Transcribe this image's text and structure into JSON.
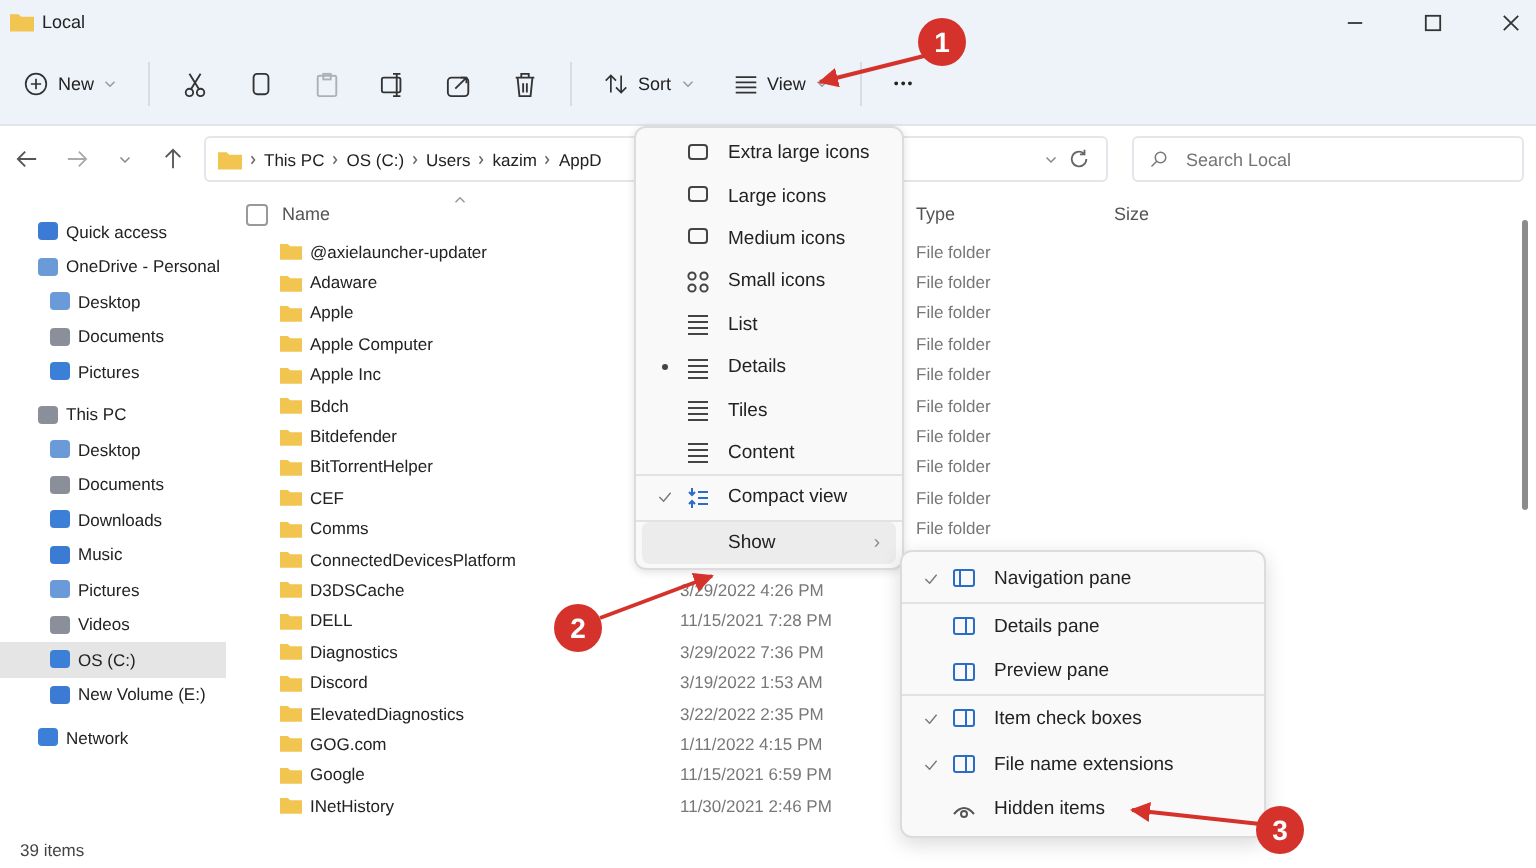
{
  "window": {
    "title": "Local"
  },
  "toolbar": {
    "new": "New",
    "tools": [
      {
        "kind": "cut",
        "disabled": false
      },
      {
        "kind": "copy",
        "disabled": false
      },
      {
        "kind": "paste",
        "disabled": true
      },
      {
        "kind": "rename",
        "disabled": false
      },
      {
        "kind": "share",
        "disabled": false
      },
      {
        "kind": "delete",
        "disabled": false
      }
    ],
    "sort": "Sort",
    "view": "View",
    "more": "•••"
  },
  "address": {
    "crumbs": [
      "This PC",
      "OS (C:)",
      "Users",
      "kazim",
      "AppD"
    ],
    "search_placeholder": "Search Local"
  },
  "sidebar": {
    "items": [
      {
        "label": "Quick access",
        "selected": false
      },
      {
        "label": "OneDrive - Personal",
        "selected": false,
        "children": [
          {
            "label": "Desktop",
            "selected": false
          },
          {
            "label": "Documents",
            "selected": false
          },
          {
            "label": "Pictures",
            "selected": false
          }
        ]
      },
      {
        "label": "This PC",
        "selected": false,
        "children": [
          {
            "label": "Desktop",
            "selected": false
          },
          {
            "label": "Documents",
            "selected": false
          },
          {
            "label": "Downloads",
            "selected": false
          },
          {
            "label": "Music",
            "selected": false
          },
          {
            "label": "Pictures",
            "selected": false
          },
          {
            "label": "Videos",
            "selected": false
          },
          {
            "label": "OS (C:)",
            "selected": true
          },
          {
            "label": "New Volume (E:)",
            "selected": false
          }
        ]
      },
      {
        "label": "Network",
        "selected": false
      }
    ]
  },
  "table": {
    "select_all_checked": false,
    "columns": [
      "Name",
      "Type",
      "Size"
    ],
    "rows": [
      {
        "name": "@axielauncher-updater",
        "type": "File folder"
      },
      {
        "name": "Adaware",
        "type": "File folder"
      },
      {
        "name": "Apple",
        "type": "File folder"
      },
      {
        "name": "Apple Computer",
        "type": "File folder"
      },
      {
        "name": "Apple Inc",
        "type": "File folder"
      },
      {
        "name": "Bdch",
        "type": "File folder"
      },
      {
        "name": "Bitdefender",
        "type": "File folder"
      },
      {
        "name": "BitTorrentHelper",
        "type": "File folder"
      },
      {
        "name": "CEF",
        "type": "File folder"
      },
      {
        "name": "Comms",
        "type": "File folder"
      },
      {
        "name": "ConnectedDevicesPlatform"
      },
      {
        "name": "D3DSCache",
        "date": "3/29/2022 4:26 PM"
      },
      {
        "name": "DELL",
        "date": "11/15/2021 7:28 PM"
      },
      {
        "name": "Diagnostics",
        "date": "3/29/2022 7:36 PM"
      },
      {
        "name": "Discord",
        "date": "3/19/2022 1:53 AM"
      },
      {
        "name": "ElevatedDiagnostics",
        "date": "3/22/2022 2:35 PM"
      },
      {
        "name": "GOG.com",
        "date": "1/11/2022 4:15 PM"
      },
      {
        "name": "Google",
        "date": "11/15/2021 6:59 PM"
      },
      {
        "name": "INetHistory",
        "date": "11/30/2021 2:46 PM"
      }
    ]
  },
  "view_menu": {
    "items": [
      {
        "kind": "view",
        "label": "Extra large icons",
        "selected": false
      },
      {
        "kind": "view",
        "label": "Large icons",
        "selected": false
      },
      {
        "kind": "view",
        "label": "Medium icons",
        "selected": false
      },
      {
        "kind": "view",
        "label": "Small icons",
        "selected": false
      },
      {
        "kind": "view",
        "label": "List",
        "selected": false
      },
      {
        "kind": "view",
        "label": "Details",
        "selected": true
      },
      {
        "kind": "view",
        "label": "Tiles",
        "selected": false
      },
      {
        "kind": "view",
        "label": "Content",
        "selected": false
      },
      {
        "kind": "toggle",
        "label": "Compact view",
        "checked": true
      },
      {
        "kind": "submenu",
        "label": "Show",
        "highlighted": true,
        "chevron": "›"
      }
    ]
  },
  "show_menu": {
    "items": [
      {
        "label": "Navigation pane",
        "checked": true
      },
      {
        "label": "Details pane",
        "checked": false
      },
      {
        "label": "Preview pane",
        "checked": false
      },
      {
        "label": "Item check boxes",
        "checked": true
      },
      {
        "label": "File name extensions",
        "checked": true
      },
      {
        "label": "Hidden items",
        "checked": false
      }
    ]
  },
  "annotations": [
    "1",
    "2",
    "3"
  ],
  "status_bar": {
    "count": "39 items"
  }
}
